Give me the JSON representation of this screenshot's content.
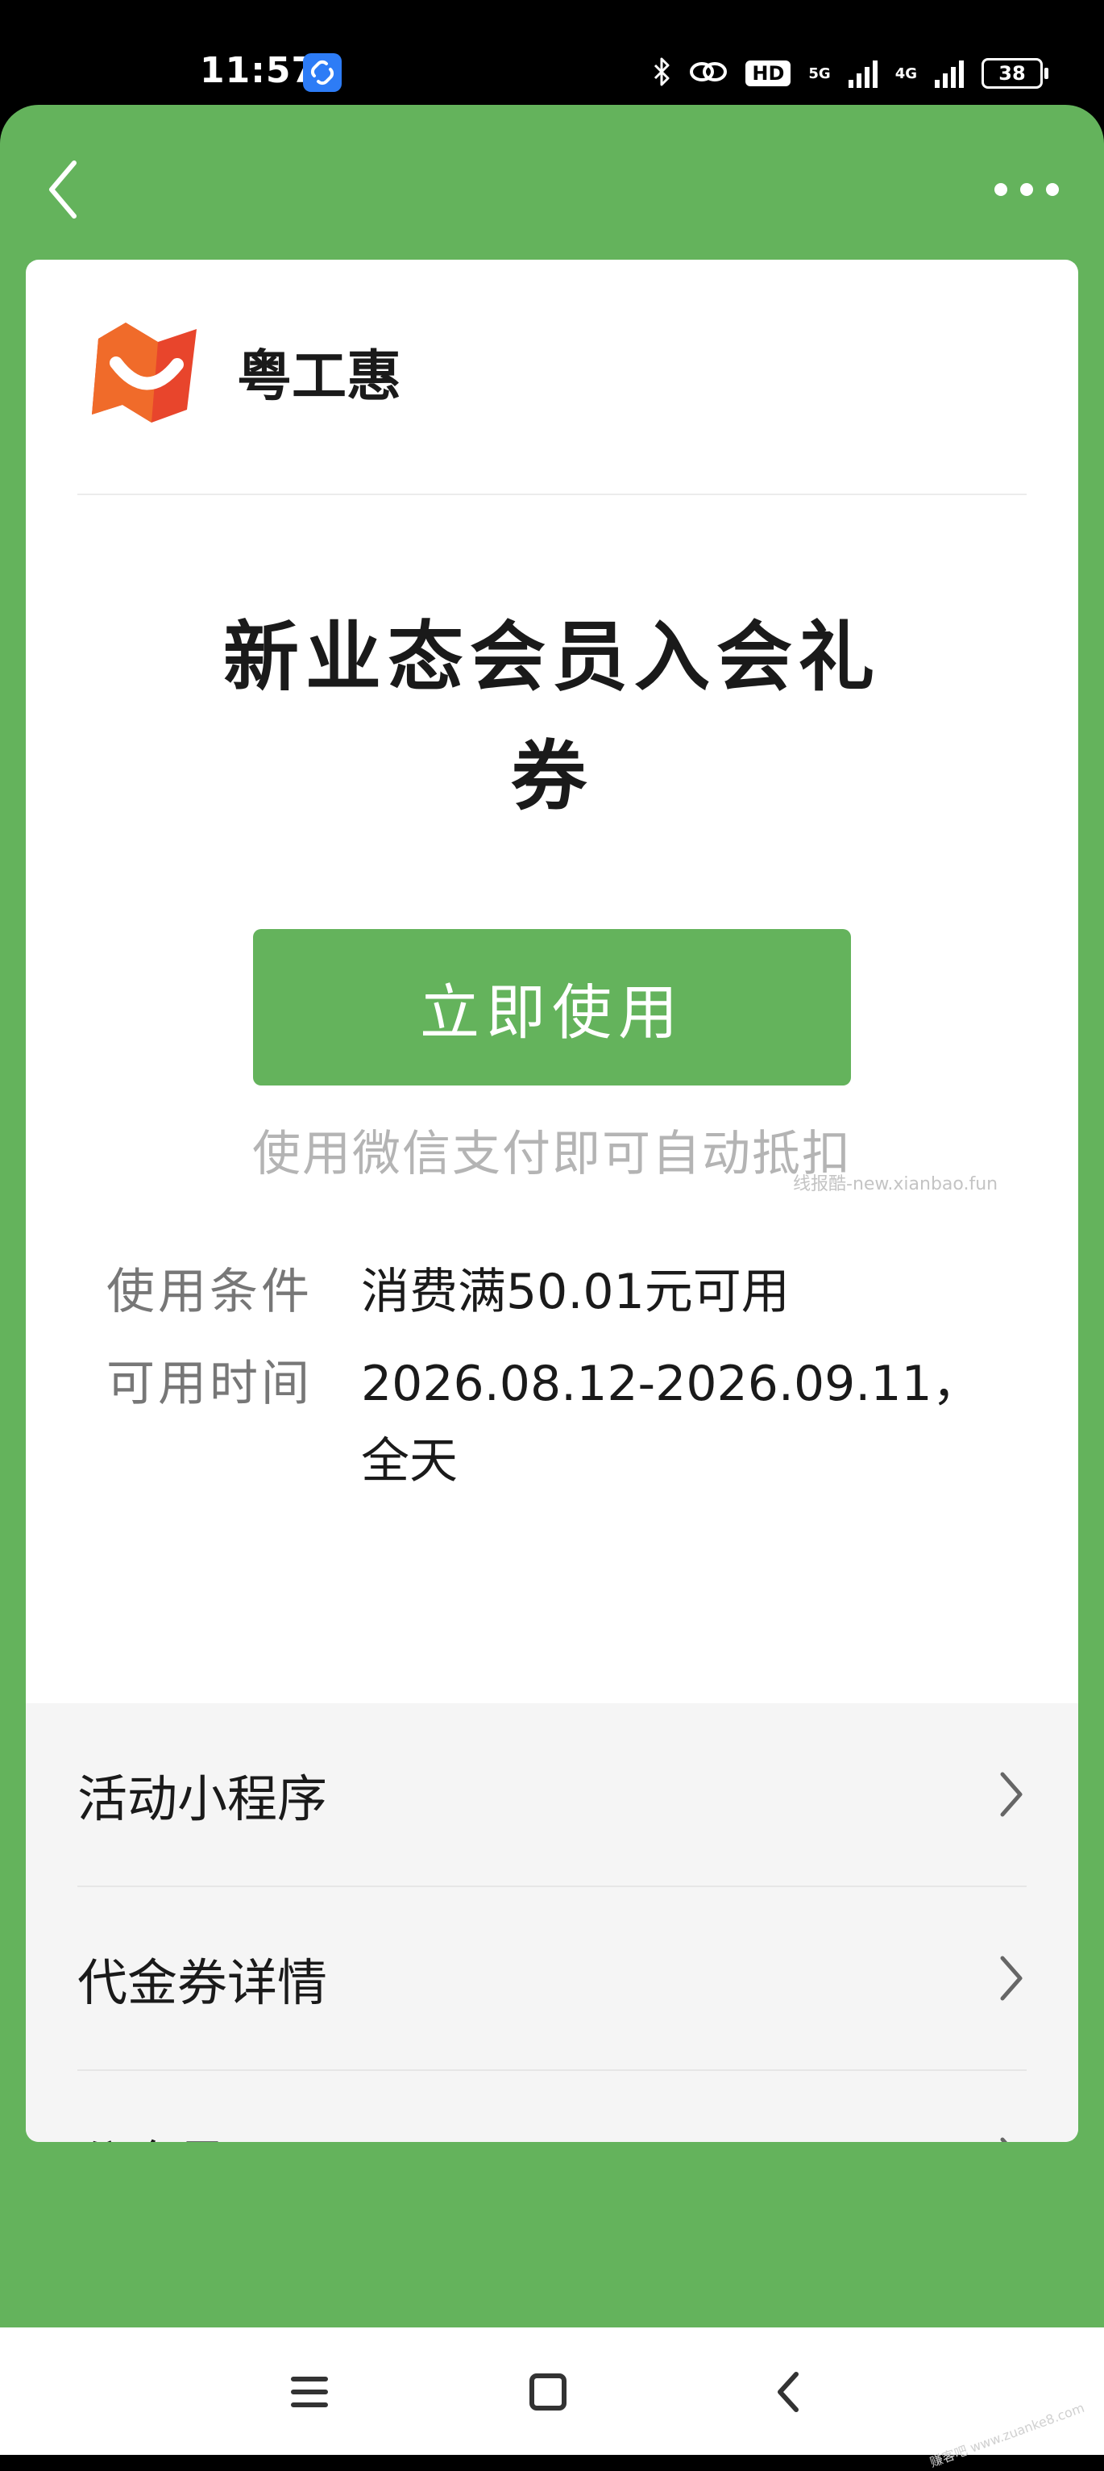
{
  "status_bar": {
    "time": "11:57",
    "network_1": "5G",
    "network_2": "4G",
    "hd_label": "HD",
    "battery": "38"
  },
  "brand": {
    "name": "粤工惠",
    "logo_icon": "gonghui-logo-icon",
    "logo_color": "#e8452c"
  },
  "coupon": {
    "title_line1": "新业态会员入会礼",
    "title_line2": "券",
    "use_button_label": "立即使用",
    "pay_hint": "使用微信支付即可自动抵扣",
    "watermark": "线报酷-new.xianbao.fun"
  },
  "details": [
    {
      "label": "使用条件",
      "value": "消费满50.01元可用"
    },
    {
      "label": "可用时间",
      "value": "2026.08.12-2026.09.11，全天"
    }
  ],
  "menu": [
    {
      "label": "活动小程序"
    },
    {
      "label": "代金券详情"
    },
    {
      "label": "公众号"
    }
  ],
  "theme": {
    "accent": "#64b35c",
    "card_bg": "#ffffff",
    "menu_bg": "#f5f5f5",
    "hint_color": "#b4b4b4"
  },
  "corner_mark": "赚客吧 www.zuanke8.com"
}
